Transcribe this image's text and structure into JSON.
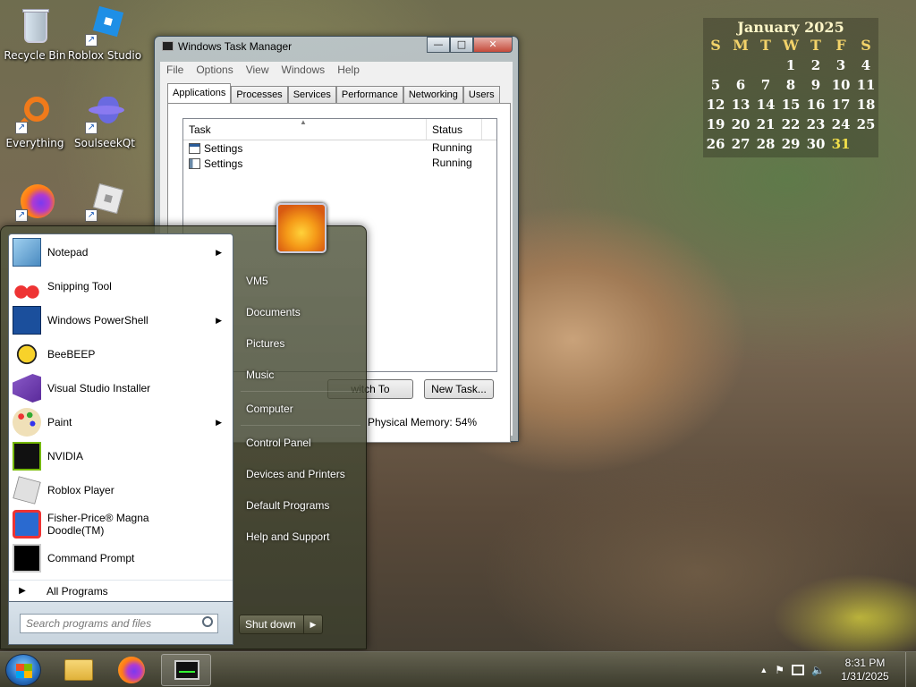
{
  "desktop": {
    "icons": [
      {
        "label": "Recycle Bin"
      },
      {
        "label": "Roblox Studio"
      },
      {
        "label": "Everything"
      },
      {
        "label": "SoulseekQt"
      },
      {
        "label": "Firefox"
      },
      {
        "label": "Roblox Player"
      }
    ]
  },
  "calendar": {
    "title": "January 2025",
    "weekdays": [
      "S",
      "M",
      "T",
      "W",
      "T",
      "F",
      "S"
    ],
    "weeks": [
      [
        "",
        "",
        "",
        "1",
        "2",
        "3",
        "4"
      ],
      [
        "5",
        "6",
        "7",
        "8",
        "9",
        "10",
        "11"
      ],
      [
        "12",
        "13",
        "14",
        "15",
        "16",
        "17",
        "18"
      ],
      [
        "19",
        "20",
        "21",
        "22",
        "23",
        "24",
        "25"
      ],
      [
        "26",
        "27",
        "28",
        "29",
        "30",
        "31",
        ""
      ]
    ],
    "today": "31"
  },
  "task_manager": {
    "title": "Windows Task Manager",
    "menu": [
      "File",
      "Options",
      "View",
      "Windows",
      "Help"
    ],
    "tabs": [
      "Applications",
      "Processes",
      "Services",
      "Performance",
      "Networking",
      "Users"
    ],
    "active_tab": "Applications",
    "columns": [
      "Task",
      "Status"
    ],
    "rows": [
      {
        "task": "Settings",
        "status": "Running"
      },
      {
        "task": "Settings",
        "status": "Running"
      }
    ],
    "switch_to_label": "witch To",
    "new_task_label": "New Task...",
    "physical_memory": "Physical Memory: 54%",
    "buttons": {
      "minimize": "—",
      "maximize": "□",
      "close": "✕"
    }
  },
  "start_menu": {
    "programs": [
      {
        "label": "Notepad",
        "submenu": true,
        "icon": "notepad-icon"
      },
      {
        "label": "Snipping Tool",
        "submenu": false,
        "icon": "scissors-icon"
      },
      {
        "label": "Windows PowerShell",
        "submenu": true,
        "icon": "powershell-icon"
      },
      {
        "label": "BeeBEEP",
        "submenu": false,
        "icon": "bee-icon"
      },
      {
        "label": "Visual Studio Installer",
        "submenu": false,
        "icon": "visual-studio-icon"
      },
      {
        "label": "Paint",
        "submenu": true,
        "icon": "paint-palette-icon"
      },
      {
        "label": "NVIDIA",
        "submenu": false,
        "icon": "nvidia-icon"
      },
      {
        "label": "Roblox Player",
        "submenu": false,
        "icon": "roblox-icon"
      },
      {
        "label": "Fisher-Price® Magna Doodle(TM)",
        "submenu": false,
        "icon": "magna-doodle-icon"
      },
      {
        "label": "Command Prompt",
        "submenu": false,
        "icon": "command-prompt-icon"
      }
    ],
    "all_programs": "All Programs",
    "search_placeholder": "Search programs and files",
    "right_items": [
      "VM5",
      "Documents",
      "Pictures",
      "Music",
      "Computer",
      "Control Panel",
      "Devices and Printers",
      "Default Programs",
      "Help and Support"
    ],
    "shutdown_label": "Shut down"
  },
  "taskbar": {
    "time": "8:31 PM",
    "date": "1/31/2025"
  },
  "colors": {
    "accent": "#2a74c6",
    "calendar_header": "#f3d36a",
    "calendar_today": "#f3e04a"
  }
}
